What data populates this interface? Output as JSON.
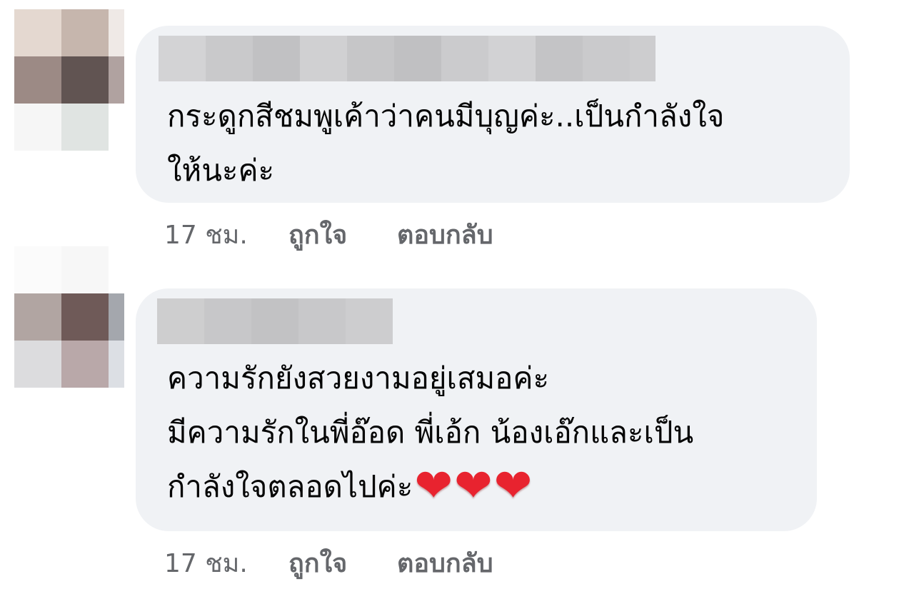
{
  "comments": [
    {
      "lines": [
        "กระดูกสีชมพูเค้าว่าคนมีบุญค่ะ..เป็นกำลังใจ",
        "ให้นะค่ะ"
      ],
      "time": "17 ชม.",
      "like_label": "ถูกใจ",
      "reply_label": "ตอบกลับ"
    },
    {
      "lines": [
        "ความรักยังสวยงามอยู่เสมอค่ะ",
        "มีความรักในพี่อ๊อด พี่เอ้ก น้องเอ๊กและเป็น",
        "กำลังใจตลอดไปค่ะ"
      ],
      "emoji": "❤",
      "time": "17 ชม.",
      "like_label": "ถูกใจ",
      "reply_label": "ตอบกลับ"
    }
  ],
  "colors": {
    "bubble": "#f0f2f5",
    "meta_text": "#65676b",
    "heart": "#e8232f"
  }
}
